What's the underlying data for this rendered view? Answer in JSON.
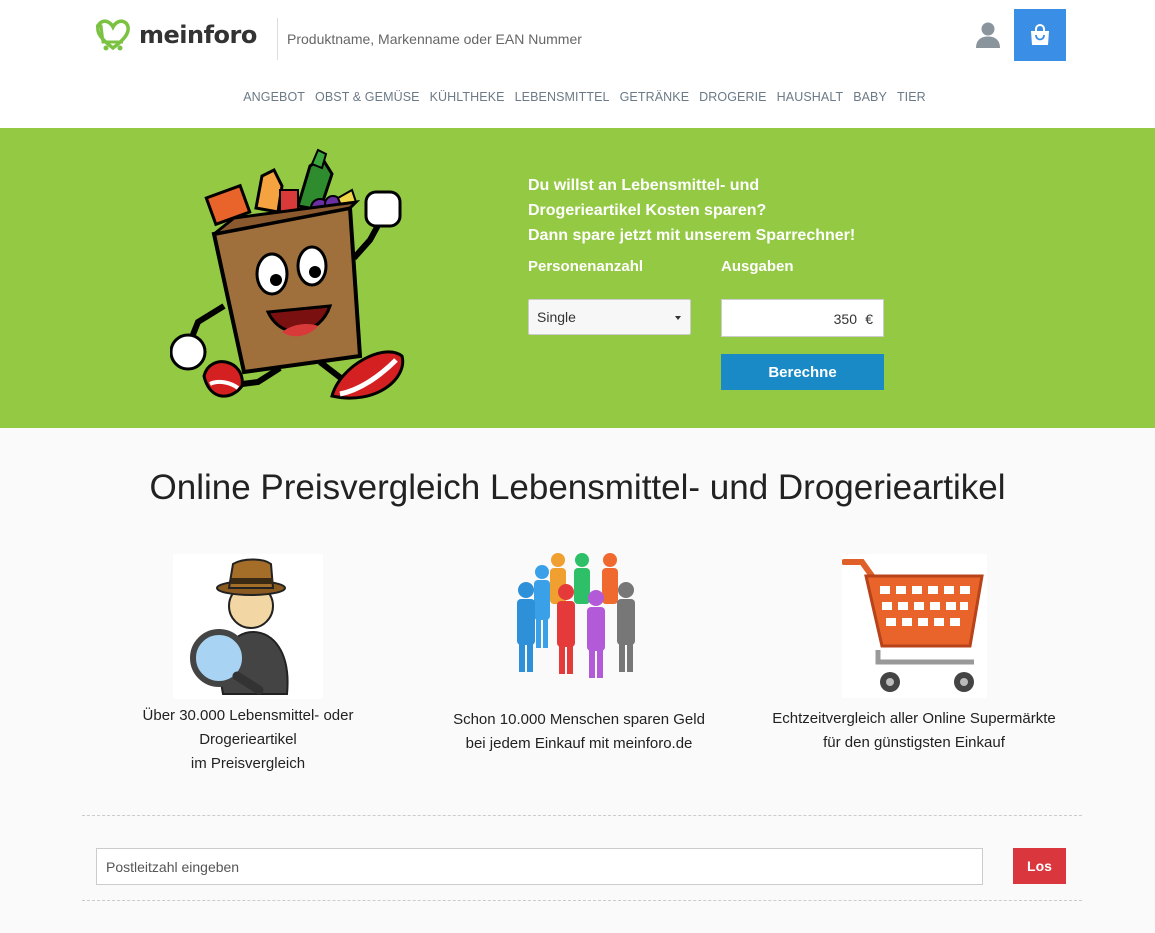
{
  "header": {
    "logo_text": "meinforo",
    "search_placeholder": "Produktname, Markenname oder EAN Nummer"
  },
  "nav": {
    "items": [
      "ANGEBOT",
      "OBST & GEMÜSE",
      "KÜHLTHEKE",
      "LEBENSMITTEL",
      "GETRÄNKE",
      "DROGERIE",
      "HAUSHALT",
      "BABY",
      "TIER"
    ]
  },
  "hero": {
    "headline_line1": "Du willst an Lebensmittel- und",
    "headline_line2": "Drogerieartikel Kosten sparen?",
    "headline_line3": "Dann spare jetzt mit unserem Sparrechner!",
    "persons_label": "Personenanzahl",
    "expenses_label": "Ausgaben",
    "persons_value": "Single",
    "expenses_value": "350",
    "expenses_unit": "€",
    "calc_button": "Berechne"
  },
  "main": {
    "title": "Online Preisvergleich Lebensmittel- und Drogerieartikel",
    "features": [
      {
        "line1": "Über 30.000 Lebensmittel- oder",
        "line2": "Drogerieartikel",
        "line3": "im Preisvergleich",
        "icon": "detective-magnifier-icon"
      },
      {
        "line1": "Schon 10.000 Menschen sparen Geld",
        "line2": "bei jedem Einkauf mit meinforo.de",
        "icon": "people-group-icon"
      },
      {
        "line1": "Echtzeitvergleich aller Online Supermärkte",
        "line2": "für den günstigsten Einkauf",
        "icon": "shopping-cart-icon"
      }
    ]
  },
  "zip": {
    "placeholder": "Postleitzahl eingeben",
    "button": "Los"
  },
  "colors": {
    "hero_green": "#94c944",
    "cart_blue": "#3a8ee6",
    "calc_blue": "#1a8ac6",
    "go_red": "#d9363e",
    "logo_green": "#7cc242"
  }
}
